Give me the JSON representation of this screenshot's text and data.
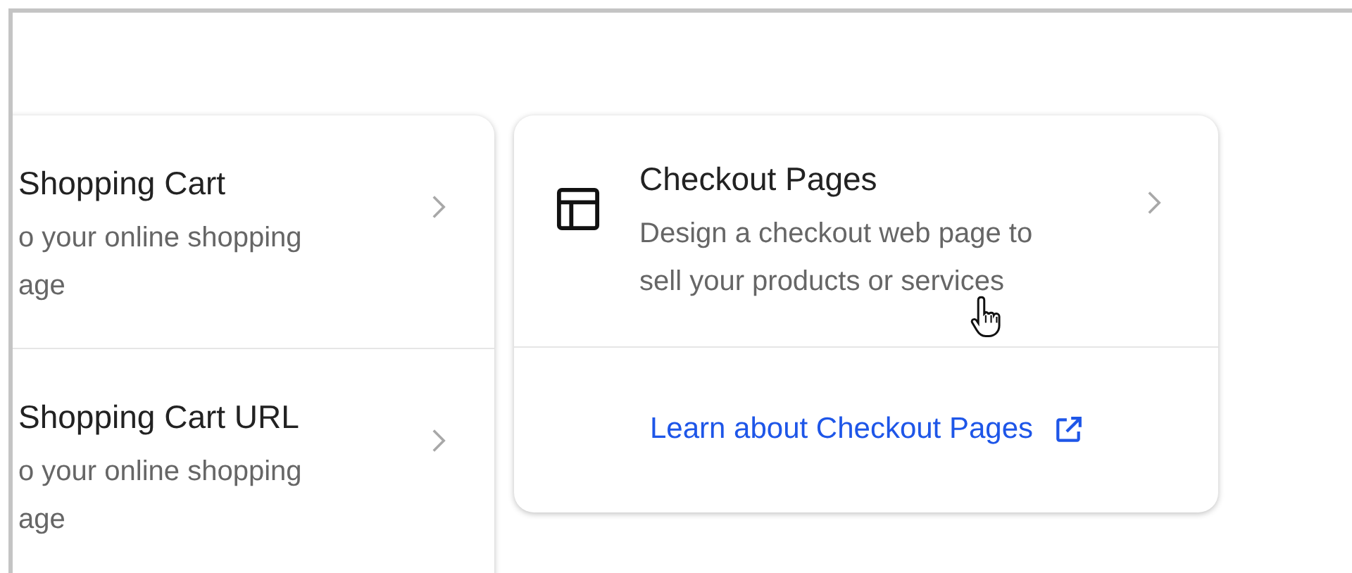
{
  "left_card": {
    "items": [
      {
        "title": "Shopping Cart",
        "description_lines": [
          "o your online shopping",
          "age"
        ]
      },
      {
        "title": "Shopping Cart URL",
        "description_lines": [
          "o your online shopping",
          "age"
        ]
      }
    ]
  },
  "checkout_card": {
    "title": "Checkout Pages",
    "description": "Design a checkout web page to sell your products or services",
    "link": "Learn about Checkout Pages"
  }
}
